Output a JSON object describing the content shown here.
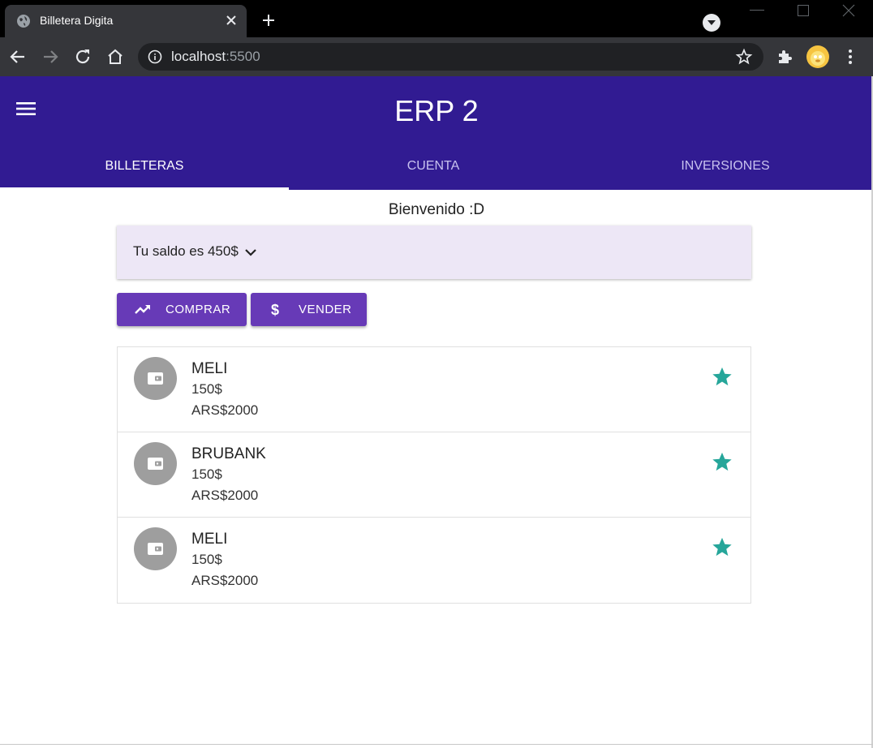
{
  "browser": {
    "tab_title": "Billetera Digita",
    "url_host": "localhost",
    "url_port": ":5500"
  },
  "app": {
    "title": "ERP 2",
    "tabs": [
      {
        "label": "BILLETERAS",
        "active": true
      },
      {
        "label": "CUENTA",
        "active": false
      },
      {
        "label": "INVERSIONES",
        "active": false
      }
    ],
    "welcome": "Bienvenido :D",
    "balance_label": "Tu saldo es 450$",
    "buttons": {
      "buy": "COMPRAR",
      "sell": "VENDER"
    },
    "wallets": [
      {
        "name": "MELI",
        "usd": "150$",
        "ars": "ARS$2000",
        "icon": "wallet-icon",
        "favorite": true
      },
      {
        "name": "BRUBANK",
        "usd": "150$",
        "ars": "ARS$2000",
        "icon": "wallet-icon",
        "favorite": true
      },
      {
        "name": "MELI",
        "usd": "150$",
        "ars": "ARS$2000",
        "icon": "wallet-icon",
        "favorite": true
      }
    ]
  },
  "colors": {
    "appbar": "#311b92",
    "button": "#673ab7",
    "balance_bg": "#ede7f6",
    "star": "#26a69a",
    "avatar": "#9e9e9e"
  }
}
